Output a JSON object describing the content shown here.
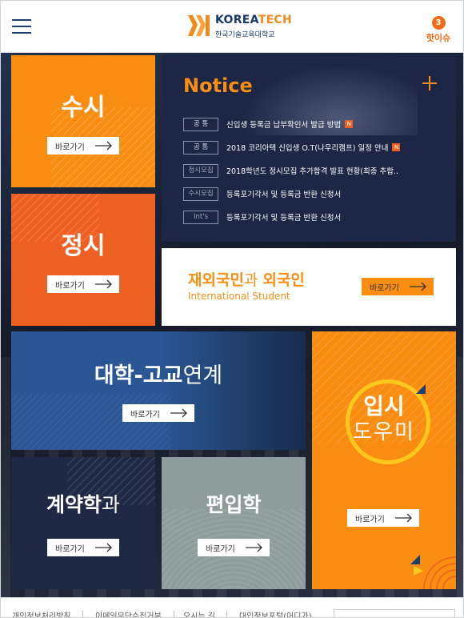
{
  "header": {
    "logo_en_1": "KOREA",
    "logo_en_2": "TECH",
    "logo_ko": "한국기술교육대학교",
    "hot_count": "3",
    "hot_label": "핫이슈"
  },
  "tiles": {
    "susi": {
      "title": "수시",
      "button": "바로가기"
    },
    "jungsi": {
      "title": "정시",
      "button": "바로가기"
    },
    "international": {
      "title_bold_1": "재외국민",
      "title_light": "과 ",
      "title_bold_2": "외국인",
      "subtitle": "International Student",
      "button": "바로가기"
    },
    "university": {
      "title_bold": "대학-고교",
      "title_light": "연계",
      "button": "바로가기"
    },
    "helper": {
      "title_1": "입시",
      "title_2": "도우미",
      "button": "바로가기"
    },
    "contract": {
      "title_bold": "계약학",
      "title_light": "과",
      "button": "바로가기"
    },
    "transfer": {
      "title": "편입학",
      "button": "바로가기"
    }
  },
  "notice": {
    "title": "Notice",
    "items": [
      {
        "category": "공 통",
        "text": "신입생 등록금 납부확인서 발급 방법",
        "new": "N"
      },
      {
        "category": "공 통",
        "text": "2018 코리아텍 신입생 O.T(나우리캠프) 일정 안내",
        "new": "N"
      },
      {
        "category": "정시모집",
        "text": "2018학년도 정시모집 추가합격 발표 현황(최종 추합..",
        "new": ""
      },
      {
        "category": "수시모집",
        "text": "등록포기각서 및 등록금 반환 신청서",
        "new": ""
      },
      {
        "category": "Int's",
        "text": "등록포기각서 및 등록금 반환 신청서",
        "new": ""
      }
    ]
  },
  "footer": {
    "links": [
      "개인정보처리방침",
      "이메일무단수집거부",
      "오시는 길",
      "대입정보포털(어디가)"
    ]
  },
  "colors": {
    "orange": "#f98d12",
    "deep_orange": "#ee6021",
    "navy": "#1d2745",
    "blue": "#2a5693"
  }
}
